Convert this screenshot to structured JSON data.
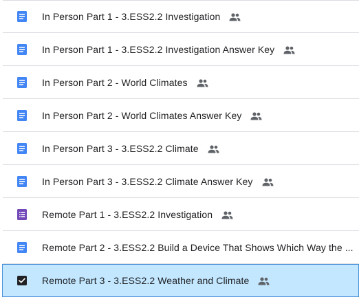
{
  "files": [
    {
      "name": "In Person Part 1 - 3.ESS2.2 Investigation",
      "icon": "google-docs-icon",
      "shared": true,
      "selected": false
    },
    {
      "name": "In Person Part 1 - 3.ESS2.2 Investigation Answer Key",
      "icon": "google-docs-icon",
      "shared": true,
      "selected": false
    },
    {
      "name": "In Person Part 2 - World Climates",
      "icon": "google-docs-icon",
      "shared": true,
      "selected": false
    },
    {
      "name": "In Person Part 2 - World Climates Answer Key",
      "icon": "google-docs-icon",
      "shared": true,
      "selected": false
    },
    {
      "name": "In Person Part 3 - 3.ESS2.2 Climate",
      "icon": "google-docs-icon",
      "shared": true,
      "selected": false
    },
    {
      "name": "In Person Part 3 - 3.ESS2.2 Climate Answer Key",
      "icon": "google-docs-icon",
      "shared": true,
      "selected": false
    },
    {
      "name": "Remote Part 1 - 3.ESS2.2 Investigation",
      "icon": "google-forms-icon",
      "shared": true,
      "selected": false
    },
    {
      "name": "Remote Part 2 - 3.ESS2.2 Build a Device That Shows Which Way the ...",
      "icon": "google-docs-icon",
      "shared": true,
      "selected": false
    },
    {
      "name": "Remote Part 3 - 3.ESS2.2 Weather and Climate",
      "icon": "checkbox-checked-icon",
      "shared": true,
      "selected": true
    }
  ],
  "colors": {
    "docs_blue": "#4285f4",
    "forms_purple": "#7248b9",
    "selected_bg": "#c2e7ff",
    "selected_border": "#4a90d9",
    "text": "#202124",
    "shared_icon": "#5f6368"
  }
}
